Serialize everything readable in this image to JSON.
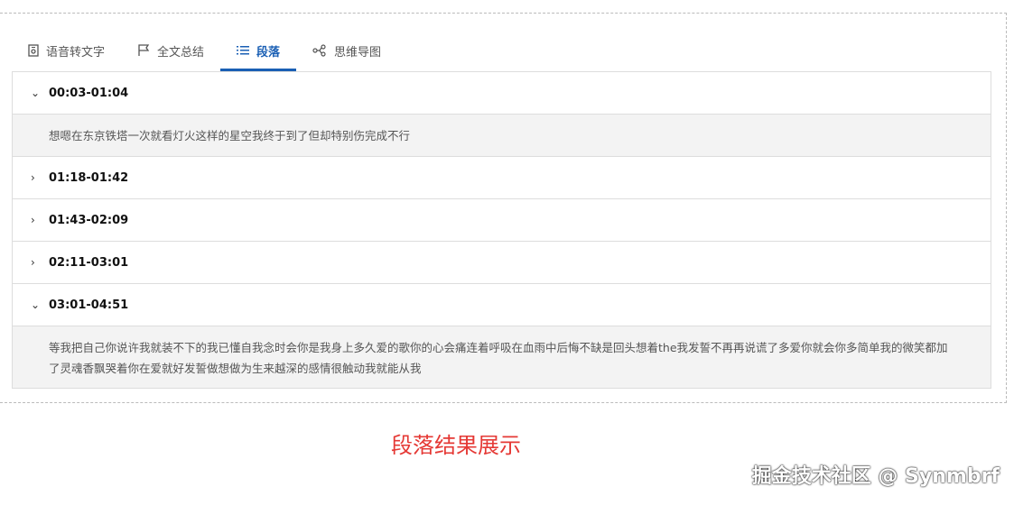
{
  "tabs": [
    {
      "label": "语音转文字",
      "icon": "audio-file-icon"
    },
    {
      "label": "全文总结",
      "icon": "flag-icon"
    },
    {
      "label": "段落",
      "icon": "list-icon",
      "active": true
    },
    {
      "label": "思维导图",
      "icon": "mindmap-icon"
    }
  ],
  "sections": [
    {
      "time": "00:03-01:04",
      "expanded": true,
      "text": "想嗯在东京铁塔一次就看灯火这样的星空我终于到了但却特别伤完成不行"
    },
    {
      "time": "01:18-01:42",
      "expanded": false
    },
    {
      "time": "01:43-02:09",
      "expanded": false
    },
    {
      "time": "02:11-03:01",
      "expanded": false
    },
    {
      "time": "03:01-04:51",
      "expanded": true,
      "text": "等我把自己你说许我就装不下的我已懂自我念时会你是我身上多久爱的歌你的心会痛连着呼吸在血雨中后悔不缺是回头想着the我发誓不再再说谎了多爱你就会你多简单我的微笑都加了灵魂香飘哭着你在爱就好发誓做想做为生来越深的感情很触动我就能从我"
    }
  ],
  "caption": "段落结果展示",
  "watermark": "掘金技术社区 @ Synmbrf",
  "colors": {
    "accent": "#1a5fb4",
    "caption": "#e53935"
  }
}
